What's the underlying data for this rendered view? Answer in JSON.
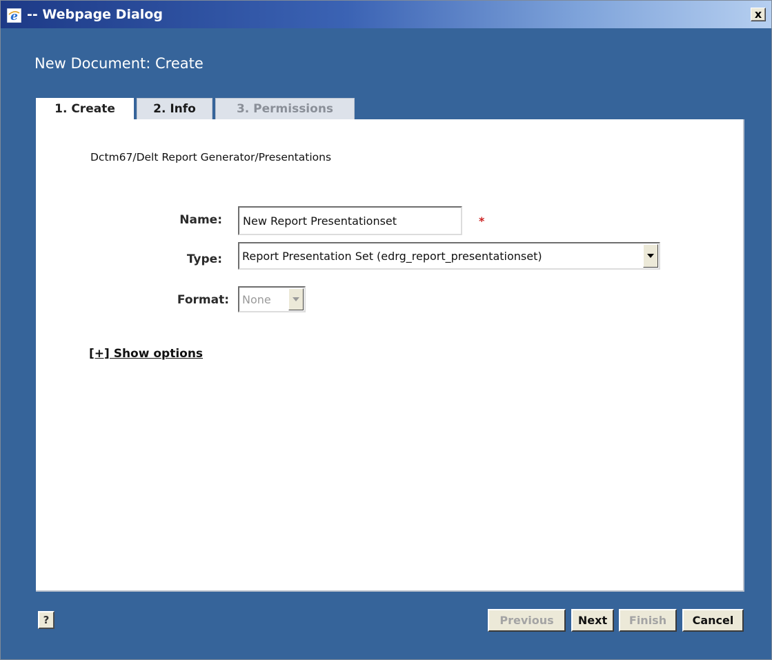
{
  "window": {
    "title": "-- Webpage Dialog",
    "close_label": "x"
  },
  "dialog": {
    "heading": "New Document: Create"
  },
  "tabs": [
    {
      "label": "1. Create",
      "state": "active"
    },
    {
      "label": "2. Info",
      "state": "enabled"
    },
    {
      "label": "3. Permissions",
      "state": "disabled"
    }
  ],
  "form": {
    "path": "Dctm67/Delt Report Generator/Presentations",
    "name_label": "Name:",
    "name_value": "New Report Presentationset",
    "required_marker": "*",
    "type_label": "Type:",
    "type_value": "Report Presentation Set (edrg_report_presentationset)",
    "format_label": "Format:",
    "format_value": "None",
    "show_options": "[+] Show options"
  },
  "footer": {
    "help_label": "?",
    "previous_label": "Previous",
    "next_label": "Next",
    "finish_label": "Finish",
    "cancel_label": "Cancel"
  },
  "colors": {
    "dialog_background": "#36649a",
    "titlebar_start": "#1d3a87",
    "titlebar_end": "#b6cff0",
    "required": "#cc2222"
  },
  "icons": {
    "app_icon": "internet-explorer-icon",
    "dropdown_arrow": "chevron-down-icon"
  }
}
